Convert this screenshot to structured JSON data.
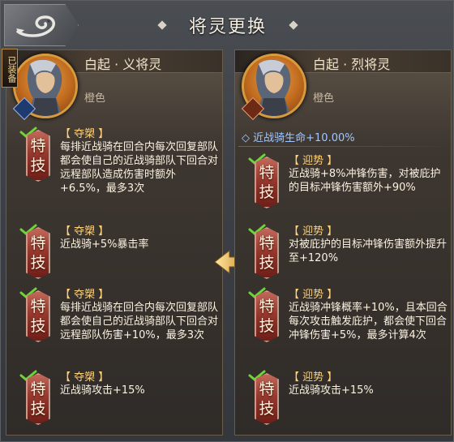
{
  "header": {
    "title": "将灵更换"
  },
  "colors": {
    "skill_name": "#ffd27a",
    "bonus": "#9fc7ff",
    "badge": "#96382e",
    "accent": "#d89a3e"
  },
  "left": {
    "equipped_tag": "已装备",
    "name": "白起 · 义将灵",
    "quality": "橙色",
    "skills": [
      {
        "badge_top": "特",
        "badge_bottom": "技",
        "name": "【 夺槊 】",
        "desc": "每排近战骑在回合内每次回复部队都会使自己的近战骑部队下回合对远程部队造成伤害时额外+6.5%，最多3次"
      },
      {
        "badge_top": "特",
        "badge_bottom": "技",
        "name": "【 夺槊 】",
        "desc": "近战骑+5%暴击率"
      },
      {
        "badge_top": "特",
        "badge_bottom": "技",
        "name": "【 夺槊 】",
        "desc": "每排近战骑在回合内每次回复部队都会使自己的近战骑部队下回合对远程部队伤害+10%，最多3次"
      },
      {
        "badge_top": "特",
        "badge_bottom": "技",
        "name": "【 夺槊 】",
        "desc": "近战骑攻击+15%"
      }
    ]
  },
  "right": {
    "name": "白起 · 烈将灵",
    "quality": "橙色",
    "bonus": "◇ 近战骑生命+10.00%",
    "skills": [
      {
        "badge_top": "特",
        "badge_bottom": "技",
        "name": "【 迎势 】",
        "desc": "近战骑+8%冲锋伤害，对被庇护的目标冲锋伤害额外+90%"
      },
      {
        "badge_top": "特",
        "badge_bottom": "技",
        "name": "【 迎势 】",
        "desc": "对被庇护的目标冲锋伤害额外提升至+120%"
      },
      {
        "badge_top": "特",
        "badge_bottom": "技",
        "name": "【 迎势 】",
        "desc": "近战骑冲锋概率+10%，且本回合每次攻击触发庇护，都会使下回合冲锋伤害+5%，最多计算4次"
      },
      {
        "badge_top": "特",
        "badge_bottom": "技",
        "name": "【 迎势 】",
        "desc": "近战骑攻击+15%"
      }
    ]
  }
}
